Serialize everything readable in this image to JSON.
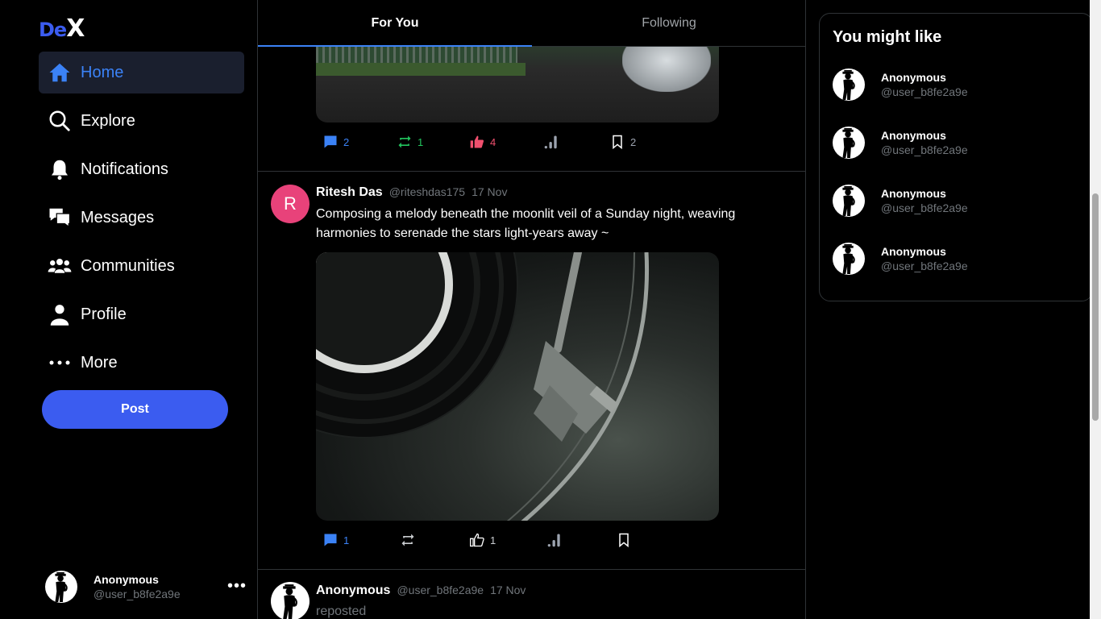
{
  "app": {
    "logo_de": "De",
    "logo_x": "X"
  },
  "nav": {
    "items": [
      {
        "label": "Home",
        "icon": "home-icon",
        "active": true
      },
      {
        "label": "Explore",
        "icon": "search-icon"
      },
      {
        "label": "Notifications",
        "icon": "bell-icon"
      },
      {
        "label": "Messages",
        "icon": "messages-icon"
      },
      {
        "label": "Communities",
        "icon": "communities-icon"
      },
      {
        "label": "Profile",
        "icon": "profile-icon"
      },
      {
        "label": "More",
        "icon": "more-dots-icon"
      }
    ],
    "post_label": "Post"
  },
  "account": {
    "name": "Anonymous",
    "handle": "@user_b8fe2a9e",
    "more": "•••"
  },
  "tabs": [
    {
      "label": "For You",
      "active": true
    },
    {
      "label": "Following"
    }
  ],
  "feed": {
    "post1": {
      "actions": {
        "comments": "2",
        "reposts": "1",
        "likes": "4",
        "bookmarks": "2"
      }
    },
    "post2": {
      "avatar_letter": "R",
      "name": "Ritesh Das",
      "handle": "@riteshdas175",
      "date": "17 Nov",
      "text": "Composing a melody beneath the moonlit veil of a Sunday night, weaving harmonies to serenade the stars light-years away ~",
      "actions": {
        "comments": "1",
        "likes": "1"
      }
    },
    "post3": {
      "name": "Anonymous",
      "handle": "@user_b8fe2a9e",
      "date": "17 Nov",
      "note": "reposted"
    }
  },
  "suggestions": {
    "title": "You might like",
    "users": [
      {
        "name": "Anonymous",
        "handle": "@user_b8fe2a9e"
      },
      {
        "name": "Anonymous",
        "handle": "@user_b8fe2a9e"
      },
      {
        "name": "Anonymous",
        "handle": "@user_b8fe2a9e"
      },
      {
        "name": "Anonymous",
        "handle": "@user_b8fe2a9e"
      }
    ]
  },
  "colors": {
    "accent": "#3b5cf0",
    "active_blue": "#3b82f6",
    "repost_green": "#22c55e",
    "like_red": "#f0506e",
    "muted": "#71767b"
  }
}
